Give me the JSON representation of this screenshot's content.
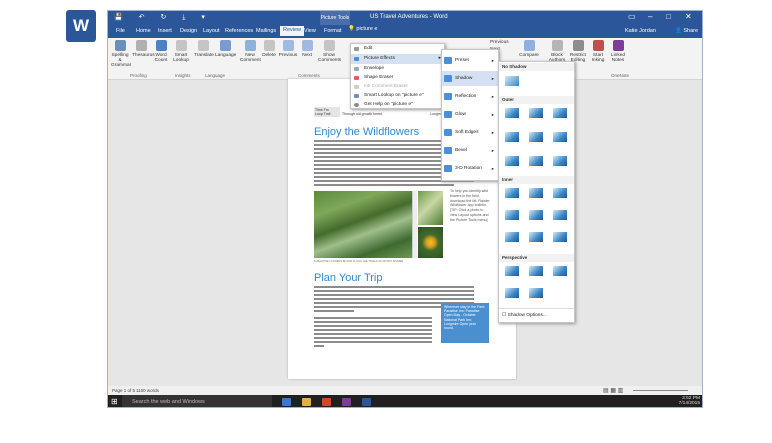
{
  "app": {
    "logo_letter": "W",
    "window_title": "US Travel Adventures - Word",
    "context_tab": "Picture Tools",
    "user": "Katie Jordan",
    "share_label": "Share",
    "tell_me": "picture e"
  },
  "tabs": [
    "File",
    "Home",
    "Insert",
    "Design",
    "Layout",
    "References",
    "Mailings",
    "Review",
    "View",
    "Format"
  ],
  "active_tab": "Review",
  "ribbon": {
    "buttons": [
      {
        "label": "Spelling & Grammar",
        "icon": "abc-check-icon"
      },
      {
        "label": "Thesaurus",
        "icon": "book-icon"
      },
      {
        "label": "Word Count",
        "icon": "abc123-icon"
      },
      {
        "label": "Smart Lookup",
        "icon": "search-icon"
      },
      {
        "label": "Translate",
        "icon": "translate-icon"
      },
      {
        "label": "Language",
        "icon": "language-icon"
      },
      {
        "label": "New Comment",
        "icon": "new-comment-icon"
      },
      {
        "label": "Delete",
        "icon": "delete-comment-icon"
      },
      {
        "label": "Previous",
        "icon": "previous-comment-icon"
      },
      {
        "label": "Next",
        "icon": "next-comment-icon"
      },
      {
        "label": "Show Comments",
        "icon": "show-comments-icon"
      },
      {
        "label": "Compare",
        "icon": "compare-icon"
      },
      {
        "label": "Block Authors",
        "icon": "block-authors-icon"
      },
      {
        "label": "Restrict Editing",
        "icon": "restrict-editing-icon"
      },
      {
        "label": "Start Inking",
        "icon": "pen-icon"
      },
      {
        "label": "Linked Notes",
        "icon": "onenote-icon"
      }
    ],
    "groups": [
      "Proofing",
      "Insights",
      "Language",
      "Comments",
      "OneNote"
    ],
    "tracking_previous": "Previous",
    "tracking_next": "Next"
  },
  "context_menu": {
    "items": [
      "Edit",
      "Picture Effects",
      "Envelope",
      "Shape Eraser",
      "Ink Comment Eraser",
      "Smart Lookup on \"picture e\"",
      "Get Help on \"picture e\""
    ],
    "highlighted": "Picture Effects"
  },
  "effects_menu": {
    "items": [
      "Preset",
      "Shadow",
      "Reflection",
      "Glow",
      "Soft Edges",
      "Bevel",
      "3-D Rotation"
    ],
    "highlighted": "Shadow"
  },
  "shadow_gallery": {
    "sections": [
      "No Shadow",
      "Outer",
      "Inner",
      "Perspective"
    ],
    "footer": "Shadow Options..."
  },
  "document": {
    "table_tabs": [
      "Time Fm",
      "Loop Trail",
      "Through old growth forest",
      "Longmire"
    ],
    "heading1": "Enjoy the Wildflowers",
    "caption": "SUBALPINE FLOWERS BLOOM ALONG THE TRAILS OF MOUNT RAINIER",
    "side_note": "To help you identify wild flowers in the field, download the Mt. Rainier Wildflower app bulletin. [TIP: Click a photo to view Layout options and the Picture Tools menu]",
    "heading2": "Plan Your Trip",
    "callout": "Wherever stay in the Park: Paradise Inn: Paradise Open May - October. National Park Inn: Longmire Open year round."
  },
  "status": {
    "page": "Page 1 of 5",
    "words": "1100 words"
  },
  "taskbar": {
    "search": "Search the web and Windows",
    "time": "3:52 PM",
    "date": "7/14/2015"
  }
}
